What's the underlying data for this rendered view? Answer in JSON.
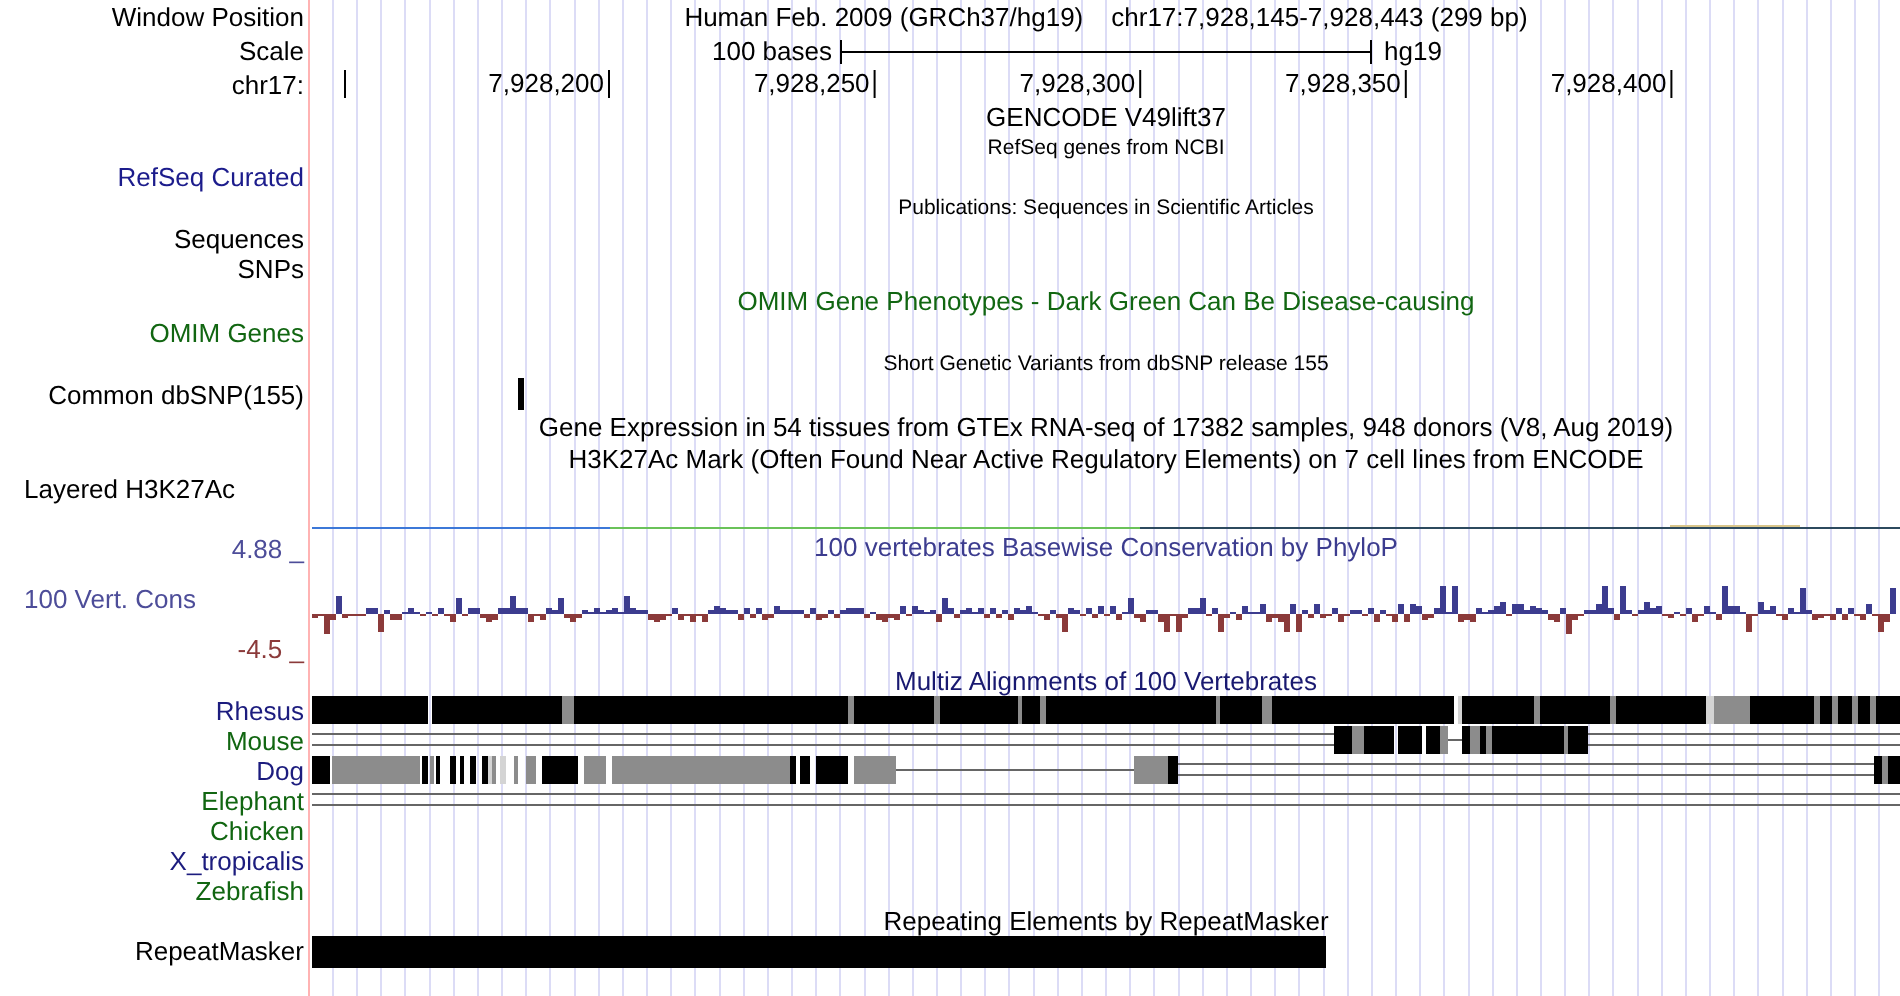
{
  "header": {
    "label": "Window Position",
    "assembly": "Human Feb. 2009 (GRCh37/hg19)",
    "position": "chr17:7,928,145-7,928,443 (299 bp)"
  },
  "scale": {
    "label": "Scale",
    "length": "100 bases",
    "assembly": "hg19"
  },
  "ruler": {
    "label": "chr17:",
    "ticks": [
      "7,928,200",
      "7,928,250",
      "7,928,300",
      "7,928,350",
      "7,928,400"
    ]
  },
  "tracks": [
    {
      "kind": "title",
      "text": "GENCODE V49lift37"
    },
    {
      "kind": "subtitle",
      "text": "RefSeq genes from NCBI"
    },
    {
      "kind": "label",
      "label": "RefSeq Curated",
      "color": "#1c1c8c"
    },
    {
      "kind": "subtitle",
      "text": "Publications: Sequences in Scientific Articles"
    },
    {
      "kind": "label",
      "label": "Sequences",
      "color": "#000000"
    },
    {
      "kind": "label",
      "label": "SNPs",
      "color": "#000000"
    },
    {
      "kind": "title",
      "text": "OMIM Gene Phenotypes - Dark Green Can Be Disease-causing",
      "color": "#116611"
    },
    {
      "kind": "label",
      "label": "OMIM Genes",
      "color": "#116611"
    },
    {
      "kind": "subtitle",
      "text": "Short Genetic Variants from dbSNP release 155"
    },
    {
      "kind": "snp",
      "label": "Common dbSNP(155)"
    },
    {
      "kind": "title",
      "text": "Gene Expression in 54 tissues from GTEx RNA-seq of 17382 samples, 948 donors (V8, Aug 2019)"
    },
    {
      "kind": "title",
      "text": "H3K27Ac Mark (Often Found Near Active Regulatory Elements) on 7 cell lines from ENCODE"
    },
    {
      "kind": "composite",
      "label": "Layered H3K27Ac"
    }
  ],
  "conservation": {
    "max": "4.88 _",
    "label": "100 Vert. Cons",
    "min": "-4.5 _",
    "title": "100 vertebrates Basewise Conservation by PhyloP"
  },
  "multiz": {
    "title": "Multiz Alignments of 100 Vertebrates",
    "species": [
      {
        "name": "Rhesus",
        "color": "#1c1c7e"
      },
      {
        "name": "Mouse",
        "color": "#116611"
      },
      {
        "name": "Dog",
        "color": "#1c1c7e"
      },
      {
        "name": "Elephant",
        "color": "#116611"
      },
      {
        "name": "Chicken",
        "color": "#116611"
      },
      {
        "name": "X_tropicalis",
        "color": "#1c1c7e"
      },
      {
        "name": "Zebrafish",
        "color": "#116611"
      }
    ]
  },
  "repeatmasker": {
    "title": "Repeating Elements by RepeatMasker",
    "label": "RepeatMasker"
  }
}
